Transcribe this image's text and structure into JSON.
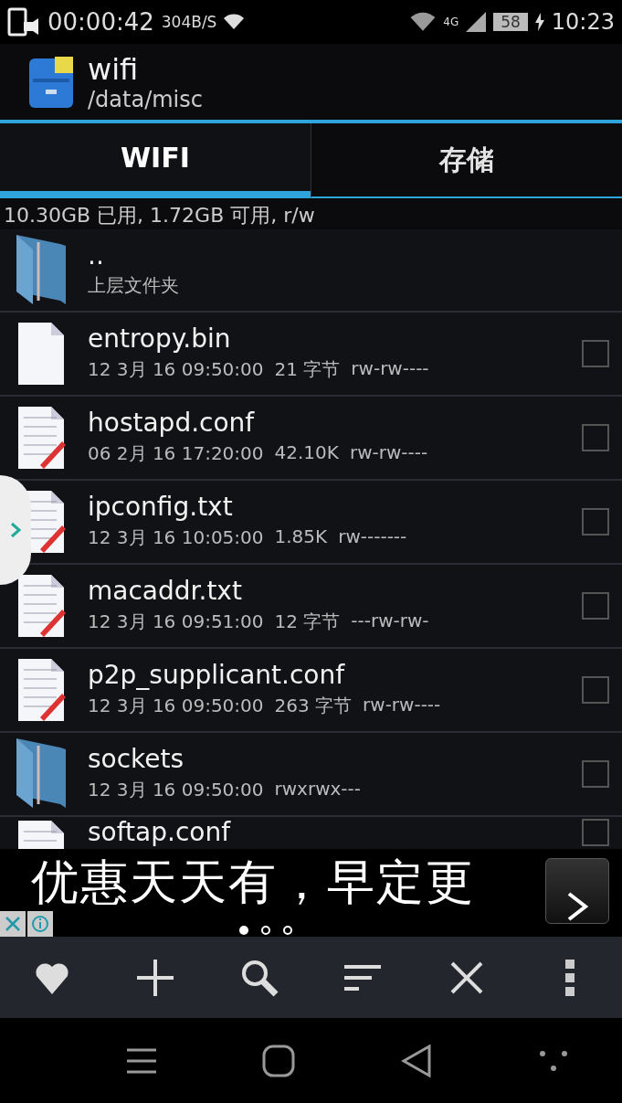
{
  "status_bar": {
    "recording_time": "00:00:42",
    "speed": "304B/S",
    "network": "4G",
    "battery": "58",
    "time": "10:23"
  },
  "header": {
    "title": "wifi",
    "path": "/data/misc"
  },
  "tabs": [
    {
      "label": "WIFI",
      "selected": true
    },
    {
      "label": "存储",
      "selected": false
    }
  ],
  "storage_info": "10.30GB 已用, 1.72GB 可用, r/w",
  "files": [
    {
      "kind": "folder",
      "name": "..",
      "meta": [
        "上层文件夹"
      ]
    },
    {
      "kind": "file",
      "name": "entropy.bin",
      "meta": [
        "12 3月 16 09:50:00",
        "21 字节",
        "rw-rw----"
      ],
      "checked": false
    },
    {
      "kind": "text",
      "name": "hostapd.conf",
      "meta": [
        "06 2月 16 17:20:00",
        "42.10K",
        "rw-rw----"
      ],
      "checked": false
    },
    {
      "kind": "text",
      "name": "ipconfig.txt",
      "meta": [
        "12 3月 16 10:05:00",
        "1.85K",
        "rw-------"
      ],
      "checked": false
    },
    {
      "kind": "text",
      "name": "macaddr.txt",
      "meta": [
        "12 3月 16 09:51:00",
        "12 字节",
        "---rw-rw-"
      ],
      "checked": false
    },
    {
      "kind": "text",
      "name": "p2p_supplicant.conf",
      "meta": [
        "12 3月 16 09:50:00",
        "263 字节",
        "rw-rw----"
      ],
      "checked": false
    },
    {
      "kind": "folder",
      "name": "sockets",
      "meta": [
        "12 3月 16 09:50:00",
        "rwxrwx---"
      ],
      "checked": false
    },
    {
      "kind": "text",
      "name": "softap.conf",
      "checked": false
    }
  ],
  "ad": {
    "text": "优惠天天有，早定更",
    "pages": [
      {
        "selected": true
      },
      {
        "selected": false
      },
      {
        "selected": false
      }
    ]
  },
  "toolbar": [
    {
      "kind": "favorite"
    },
    {
      "kind": "add"
    },
    {
      "kind": "search"
    },
    {
      "kind": "sort"
    },
    {
      "kind": "close"
    },
    {
      "kind": "more"
    }
  ],
  "nav_bar": [
    {
      "kind": "menu"
    },
    {
      "kind": "home"
    },
    {
      "kind": "back"
    },
    {
      "kind": "assist"
    }
  ]
}
